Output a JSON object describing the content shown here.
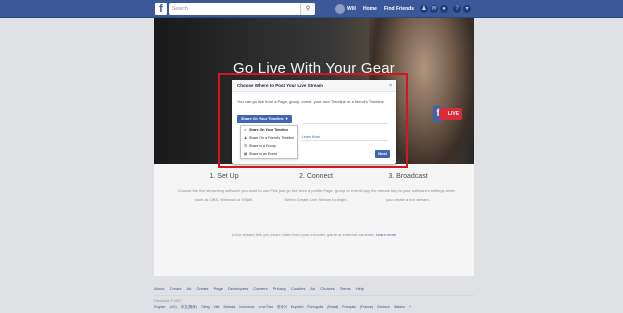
{
  "topbar": {
    "logo": "f",
    "search_placeholder": "Search",
    "search_icon": "search-icon",
    "user_name": "Will",
    "home_label": "Home",
    "find_friends_label": "Find Friends"
  },
  "hero": {
    "title": "Go Live With Your Gear",
    "live_badge": "LIVE"
  },
  "dialog": {
    "title": "Choose Where to Post Your Live Stream",
    "close": "×",
    "description": "You can go live from a Page, group, event, your own Timeline or a friend's Timeline",
    "select_label": "Share On Your Timeline",
    "select_caret": "▾",
    "menu_items": [
      {
        "icon": "✓",
        "label": "Share On Your Timeline"
      },
      {
        "icon": "♟",
        "label": "Share On a Friend's Timeline"
      },
      {
        "icon": "☰",
        "label": "Share in a Group"
      },
      {
        "icon": "▦",
        "label": "Share in an Event"
      }
    ],
    "learn_more": "Learn More",
    "next_button": "Next"
  },
  "steps": [
    {
      "title": "1. Set Up",
      "desc": "Choose the live streaming software you want to use, such as OBS, Wirecast or XSplit."
    },
    {
      "title": "2. Connect",
      "desc": "Pick just go live from a profile Page, group or event. Select Create Live Stream to begin."
    },
    {
      "title": "3. Broadcast",
      "desc": "Copy the stream key to your software's settings when you create a live stream."
    }
  ],
  "disclaimer": {
    "text": "A live stream lets you share video from your encoder, game or external cameras.",
    "link": "Learn more"
  },
  "footer": {
    "links": "About  Create Ad  Create Page  Developers  Careers  Privacy  Cookies  Ad Choices  Terms  Help",
    "copyright": "Facebook © 2017",
    "languages": "English (US)  中文(简体)  Tiếng Việt  Bahasa Indonesia  ภาษาไทย  한국어  Español  Português (Brasil)  Français (France)  Deutsch  Italiano  +"
  }
}
